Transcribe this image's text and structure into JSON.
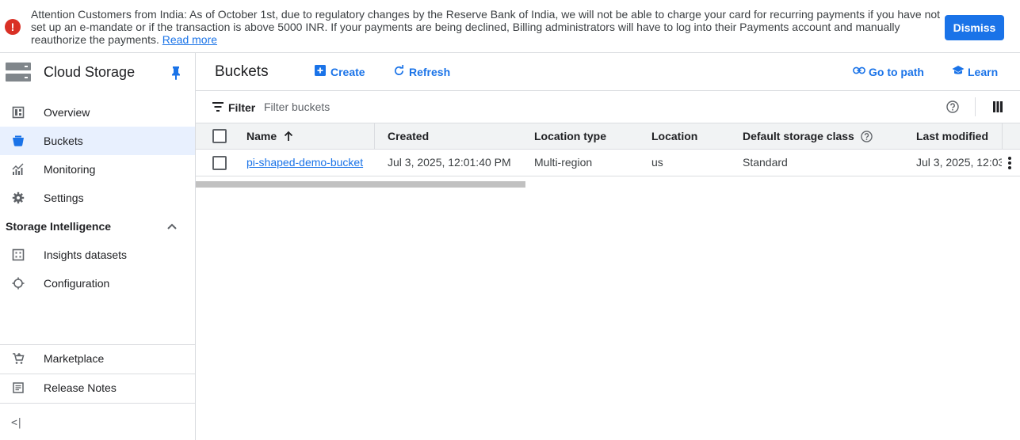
{
  "banner": {
    "message": "Attention Customers from India: As of October 1st, due to regulatory changes by the Reserve Bank of India, we will not be able to charge your card for recurring payments if you have not set up an e-mandate or if the transaction is above 5000 INR. If your payments are being declined, Billing administrators will have to log into their Payments account and manually reauthorize the payments.",
    "read_more": "Read more",
    "dismiss": "Dismiss"
  },
  "sidebar": {
    "title": "Cloud Storage",
    "items": [
      {
        "label": "Overview",
        "icon": "dashboard-icon"
      },
      {
        "label": "Buckets",
        "icon": "bucket-icon",
        "active": true
      },
      {
        "label": "Monitoring",
        "icon": "monitoring-icon"
      },
      {
        "label": "Settings",
        "icon": "gear-icon"
      }
    ],
    "section": {
      "title": "Storage Intelligence",
      "items": [
        {
          "label": "Insights datasets",
          "icon": "grid-icon"
        },
        {
          "label": "Configuration",
          "icon": "config-icon"
        }
      ]
    },
    "footer_items": [
      {
        "label": "Marketplace",
        "icon": "cart-icon"
      },
      {
        "label": "Release Notes",
        "icon": "notes-icon"
      }
    ],
    "collapse": "<|"
  },
  "toolbar": {
    "title": "Buckets",
    "create": "Create",
    "refresh": "Refresh",
    "go_to_path": "Go to path",
    "learn": "Learn"
  },
  "filter": {
    "label": "Filter",
    "placeholder": "Filter buckets"
  },
  "table": {
    "columns": [
      "Name",
      "Created",
      "Location type",
      "Location",
      "Default storage class",
      "Last modified"
    ],
    "rows": [
      {
        "name": "pi-shaped-demo-bucket",
        "created": "Jul 3, 2025, 12:01:40 PM",
        "location_type": "Multi-region",
        "location": "us",
        "storage_class": "Standard",
        "last_modified": "Jul 3, 2025, 12:03"
      }
    ]
  },
  "colors": {
    "accent": "#1a73e8",
    "error": "#d93025",
    "active_bg": "#e8f0fe"
  }
}
